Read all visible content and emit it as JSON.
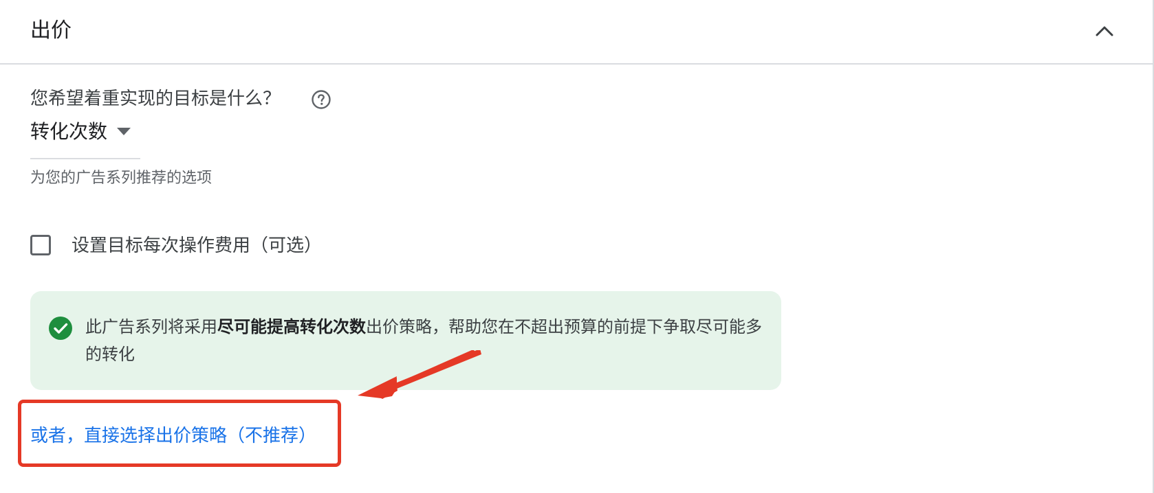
{
  "section": {
    "title": "出价",
    "collapse_icon": "chevron-up-icon"
  },
  "goal": {
    "question": "您希望着重实现的目标是什么？",
    "help_icon": "help-circle-icon",
    "selected_value": "转化次数",
    "hint": "为您的广告系列推荐的选项"
  },
  "target_cpa": {
    "label": "设置目标每次操作费用（可选）",
    "checked": false
  },
  "notice": {
    "icon": "check-circle-icon",
    "text_before": "此广告系列将采用",
    "text_bold": "尽可能提高转化次数",
    "text_after": "出价策略，帮助您在不超出预算的前提下争取尽可能多的转化",
    "background_color": "#e6f4ea",
    "icon_color": "#1e8e3e"
  },
  "alt_link": {
    "label": "或者，直接选择出价策略（不推荐）",
    "color": "#1a73e8"
  },
  "annotation": {
    "highlight_color": "#e53926"
  }
}
